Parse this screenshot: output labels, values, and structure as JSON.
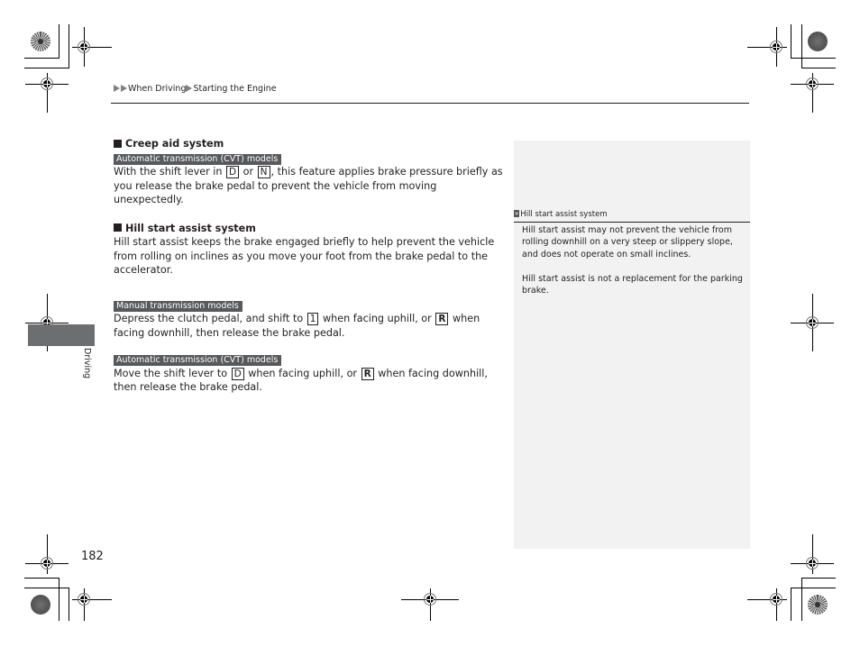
{
  "breadcrumb": {
    "items": [
      "When Driving",
      "Starting the Engine"
    ]
  },
  "main": {
    "sections": [
      {
        "heading": "Creep aid system",
        "blocks": [
          {
            "tag": "Automatic transmission (CVT) models",
            "text": {
              "t1": "With the shift lever in ",
              "k1": "D",
              "t2": " or ",
              "k2": "N",
              "t3": ", this feature applies brake pressure briefly as you release the brake pedal to prevent the vehicle from moving unexpectedly."
            }
          }
        ]
      },
      {
        "heading": "Hill start assist system",
        "intro": "Hill start assist keeps the brake engaged briefly to help prevent the vehicle from rolling on inclines as you move your foot from the brake pedal to the accelerator.",
        "blocks": [
          {
            "tag": "Manual transmission models",
            "text": {
              "t1": "Depress the clutch pedal, and shift to ",
              "k1": "1",
              "t2": " when facing uphill, or ",
              "k2": "R",
              "t3": " when facing downhill, then release the brake pedal."
            }
          },
          {
            "tag": "Automatic transmission (CVT) models",
            "text": {
              "t1": "Move the shift lever to ",
              "k1": "D",
              "t2": " when facing uphill, or ",
              "k2": "R",
              "t3": " when facing downhill, then release the brake pedal."
            }
          }
        ]
      }
    ]
  },
  "sidebar": {
    "heading_icon": "double-chevron-icon",
    "heading": "Hill start assist system",
    "paragraphs": [
      "Hill start assist may not prevent the vehicle from rolling downhill on a very steep or slippery slope, and does not operate on small inclines.",
      "Hill start assist is not a replacement for the parking brake."
    ]
  },
  "side_tab": {
    "label": "Driving"
  },
  "page_number": "182",
  "colors": {
    "tag_background": "#58595b",
    "side_tab": "#6d6e70",
    "sidebar_background": "#f2f2f2",
    "breadcrumb_arrow": "#808080"
  }
}
